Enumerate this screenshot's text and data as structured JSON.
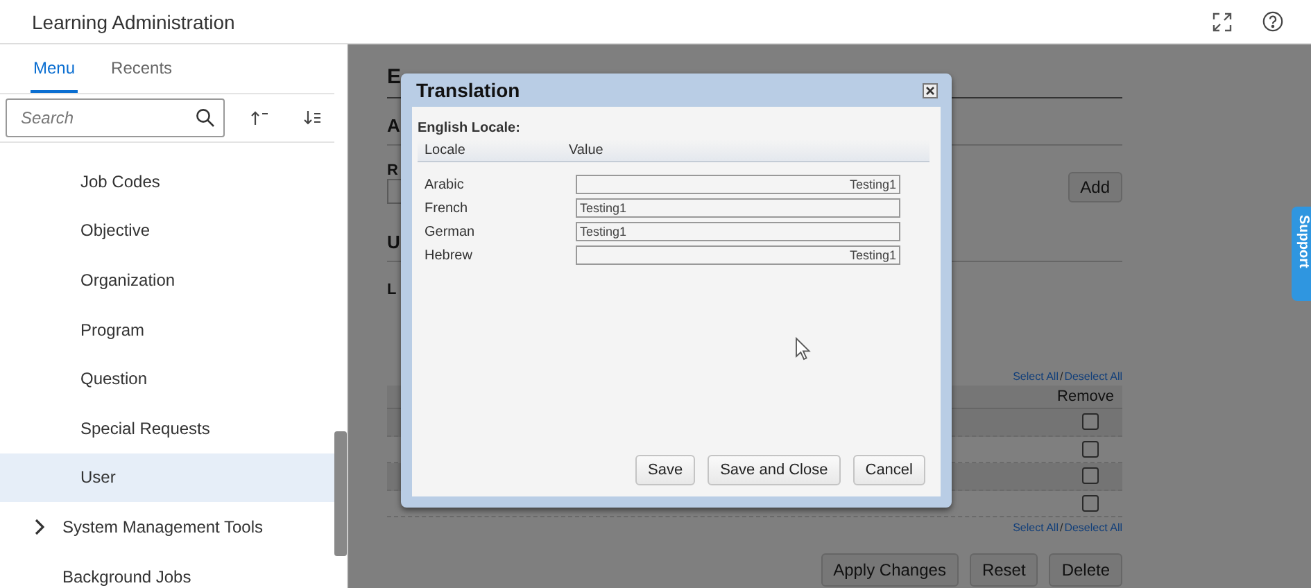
{
  "header": {
    "title": "Learning Administration"
  },
  "sidebar": {
    "tabs": [
      {
        "label": "Menu",
        "selected": true
      },
      {
        "label": "Recents",
        "selected": false
      }
    ],
    "search": {
      "placeholder": "Search"
    },
    "items": [
      {
        "label": "Job Codes",
        "kind": "child",
        "selected": false
      },
      {
        "label": "Objective",
        "kind": "child",
        "selected": false
      },
      {
        "label": "Organization",
        "kind": "child",
        "selected": false
      },
      {
        "label": "Program",
        "kind": "child",
        "selected": false
      },
      {
        "label": "Question",
        "kind": "child",
        "selected": false
      },
      {
        "label": "Special Requests",
        "kind": "child",
        "selected": false
      },
      {
        "label": "User",
        "kind": "child",
        "selected": true
      },
      {
        "label": "System Management Tools",
        "kind": "folder",
        "selected": false,
        "expanded": false
      },
      {
        "label": "Background Jobs",
        "kind": "top",
        "selected": false
      }
    ]
  },
  "page": {
    "headings": [
      "E",
      "A",
      "R",
      "U",
      "L"
    ],
    "add_button": "Add",
    "links_top": [
      "Select All",
      "/",
      "Deselect All"
    ],
    "remove_column": "Remove",
    "links_bottom": [
      "Select All",
      "/",
      "Deselect All"
    ],
    "rows": [
      {
        "checked": false
      },
      {
        "checked": false
      },
      {
        "checked": false
      },
      {
        "checked": false
      }
    ],
    "buttons": [
      "Apply Changes",
      "Reset",
      "Delete"
    ]
  },
  "support_tab": {
    "label": "Support"
  },
  "dialog": {
    "title": "Translation",
    "section_label": "English Locale:",
    "columns": [
      "Locale",
      "Value"
    ],
    "rows": [
      {
        "locale": "Arabic",
        "value": "Testing1",
        "align_right": true
      },
      {
        "locale": "French",
        "value": "Testing1",
        "align_right": false
      },
      {
        "locale": "German",
        "value": "Testing1",
        "align_right": false
      },
      {
        "locale": "Hebrew",
        "value": "Testing1",
        "align_right": true
      }
    ],
    "buttons": [
      "Save",
      "Save and Close",
      "Cancel"
    ]
  }
}
